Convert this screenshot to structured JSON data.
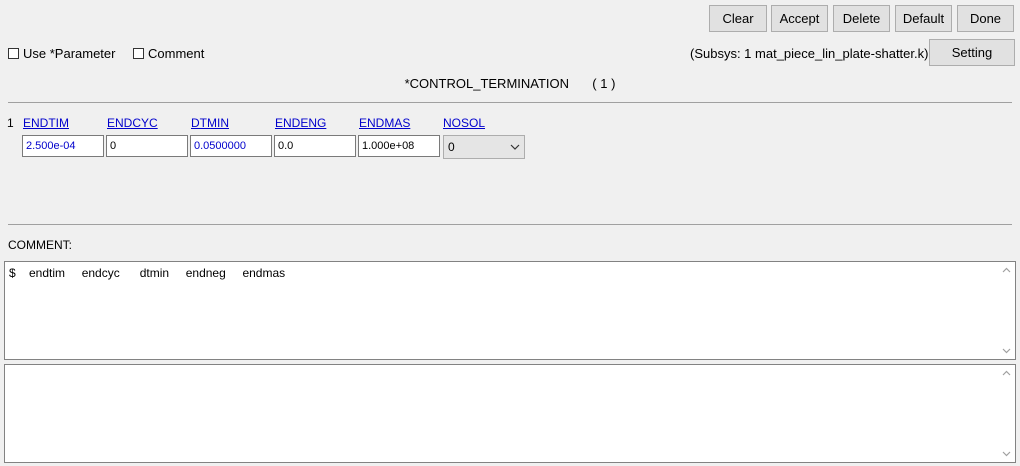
{
  "toolbar": {
    "clear": "Clear",
    "accept": "Accept",
    "delete": "Delete",
    "default": "Default",
    "done": "Done",
    "setting": "Setting"
  },
  "options": {
    "use_parameter": "Use *Parameter",
    "comment": "Comment"
  },
  "subsys": "(Subsys: 1 mat_piece_lin_plate-shatter.k)",
  "keyword_title": "*CONTROL_TERMINATION",
  "keyword_count": "( 1 )",
  "card": {
    "row_number": "1",
    "fields": [
      {
        "label": "ENDTIM",
        "value": "2.500e-04"
      },
      {
        "label": "ENDCYC",
        "value": "0"
      },
      {
        "label": "DTMIN",
        "value": "0.0500000"
      },
      {
        "label": "ENDENG",
        "value": "0.0"
      },
      {
        "label": "ENDMAS",
        "value": "1.000e+08"
      },
      {
        "label": "NOSOL",
        "value": "0"
      }
    ]
  },
  "comment_section": {
    "label": "COMMENT:",
    "text": "$    endtim     endcyc      dtmin     endneg     endmas"
  },
  "colors": {
    "background": "#f0f0f0",
    "link_blue": "#0000cc"
  }
}
